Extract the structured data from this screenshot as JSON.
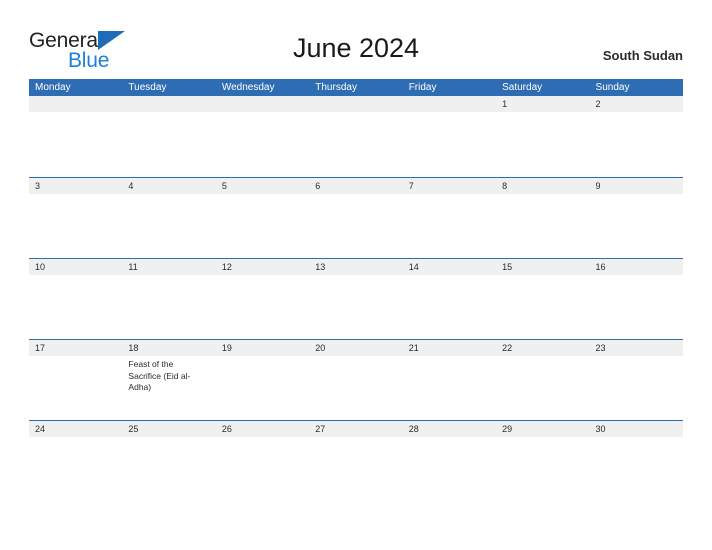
{
  "brand": {
    "line1": "General",
    "line2": "Blue",
    "flag_icon": "blue-triangle-flag",
    "color_dark": "#231f20",
    "color_blue": "#1e7fd4"
  },
  "header": {
    "title": "June 2024",
    "region": "South Sudan"
  },
  "theme": {
    "header_blue": "#2e6db4",
    "band_gray": "#f0f0f0",
    "text": "#2b2b2b",
    "page_bg": "#ffffff"
  },
  "calendar": {
    "month": "June",
    "year": "2024",
    "weekday_headers": [
      "Monday",
      "Tuesday",
      "Wednesday",
      "Thursday",
      "Friday",
      "Saturday",
      "Sunday"
    ],
    "weeks": [
      [
        {
          "day": "",
          "events": []
        },
        {
          "day": "",
          "events": []
        },
        {
          "day": "",
          "events": []
        },
        {
          "day": "",
          "events": []
        },
        {
          "day": "",
          "events": []
        },
        {
          "day": "1",
          "events": []
        },
        {
          "day": "2",
          "events": []
        }
      ],
      [
        {
          "day": "3",
          "events": []
        },
        {
          "day": "4",
          "events": []
        },
        {
          "day": "5",
          "events": []
        },
        {
          "day": "6",
          "events": []
        },
        {
          "day": "7",
          "events": []
        },
        {
          "day": "8",
          "events": []
        },
        {
          "day": "9",
          "events": []
        }
      ],
      [
        {
          "day": "10",
          "events": []
        },
        {
          "day": "11",
          "events": []
        },
        {
          "day": "12",
          "events": []
        },
        {
          "day": "13",
          "events": []
        },
        {
          "day": "14",
          "events": []
        },
        {
          "day": "15",
          "events": []
        },
        {
          "day": "16",
          "events": []
        }
      ],
      [
        {
          "day": "17",
          "events": []
        },
        {
          "day": "18",
          "events": [
            "Feast of the Sacrifice (Eid al-Adha)"
          ]
        },
        {
          "day": "19",
          "events": []
        },
        {
          "day": "20",
          "events": []
        },
        {
          "day": "21",
          "events": []
        },
        {
          "day": "22",
          "events": []
        },
        {
          "day": "23",
          "events": []
        }
      ],
      [
        {
          "day": "24",
          "events": []
        },
        {
          "day": "25",
          "events": []
        },
        {
          "day": "26",
          "events": []
        },
        {
          "day": "27",
          "events": []
        },
        {
          "day": "28",
          "events": []
        },
        {
          "day": "29",
          "events": []
        },
        {
          "day": "30",
          "events": []
        }
      ]
    ]
  }
}
